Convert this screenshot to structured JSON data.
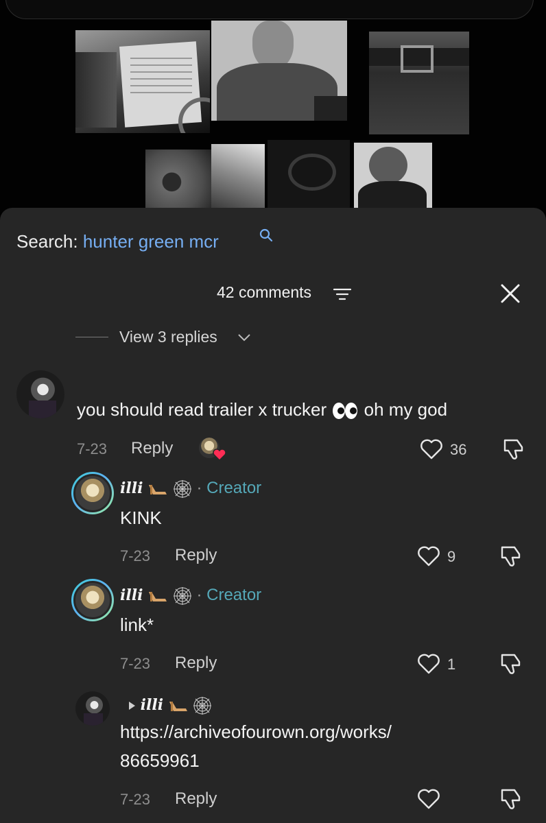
{
  "search": {
    "label": "Search:",
    "term": "hunter green mcr"
  },
  "comments_header": {
    "count_label": "42 comments"
  },
  "view_replies": {
    "label": "View 3 replies"
  },
  "comments": [
    {
      "text": "you should read trailer x trucker",
      "text_tail": "oh my god",
      "date": "7-23",
      "reply_label": "Reply",
      "likes": "36"
    },
    {
      "author": "illi",
      "tag": "Creator",
      "text": "KINK",
      "date": "7-23",
      "reply_label": "Reply",
      "likes": "9"
    },
    {
      "author": "illi",
      "tag": "Creator",
      "text": "link*",
      "date": "7-23",
      "reply_label": "Reply",
      "likes": "1"
    },
    {
      "reply_to": "illi",
      "text_line1": "https://archiveofourown.org/works/",
      "text_line2": "86659961",
      "date": "7-23",
      "reply_label": "Reply",
      "likes": ""
    }
  ],
  "colors": {
    "sheet": "#262626",
    "accent_search": "#76aef2",
    "creator": "#55a8b8",
    "heart": "#ff2d55"
  },
  "icons": [
    "search-icon",
    "filter-icon",
    "close-icon",
    "chevron-down-icon",
    "heart-outline-icon",
    "thumbs-down-icon",
    "high-heel-emoji",
    "spider-web-emoji",
    "eyes-emoji",
    "liked-by-creator-heart-icon",
    "reply-arrow-icon"
  ]
}
